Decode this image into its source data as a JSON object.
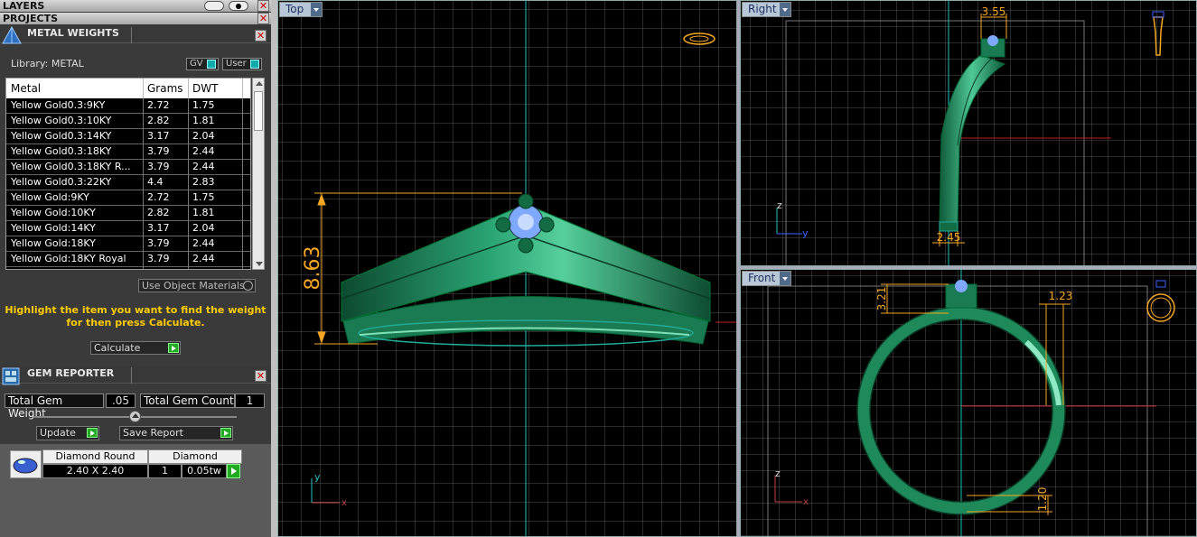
{
  "layers_title": "LAYERS",
  "projects_title": "PROJECTS",
  "close_glyph": "✕",
  "metal_weights": {
    "title": "METAL WEIGHTS",
    "library_label": "Library: METAL",
    "toggle_gv": "GV",
    "toggle_user": "User",
    "columns": [
      "Metal",
      "Grams",
      "DWT"
    ],
    "rows": [
      [
        "Yellow Gold0.3:9KY",
        "2.72",
        "1.75"
      ],
      [
        "Yellow Gold0.3:10KY",
        "2.82",
        "1.81"
      ],
      [
        "Yellow Gold0.3:14KY",
        "3.17",
        "2.04"
      ],
      [
        "Yellow Gold0.3:18KY",
        "3.79",
        "2.44"
      ],
      [
        "Yellow Gold0.3:18KY R...",
        "3.79",
        "2.44"
      ],
      [
        "Yellow Gold0.3:22KY",
        "4.4",
        "2.83"
      ],
      [
        "Yellow Gold:9KY",
        "2.72",
        "1.75"
      ],
      [
        "Yellow Gold:10KY",
        "2.82",
        "1.81"
      ],
      [
        "Yellow Gold:14KY",
        "3.17",
        "2.04"
      ],
      [
        "Yellow Gold:18KY",
        "3.79",
        "2.44"
      ],
      [
        "Yellow Gold:18KY Royal",
        "3.79",
        "2.44"
      ]
    ],
    "use_object_materials": "Use Object Materials",
    "hint_line1": "Highlight the item you want to find the weight",
    "hint_line2": "for then press Calculate.",
    "calculate_label": "Calculate"
  },
  "gem_reporter": {
    "title": "GEM REPORTER",
    "total_weight_label": "Total Gem Weight",
    "total_weight_value": ".05",
    "total_count_label": "Total Gem Count",
    "total_count_value": "1",
    "update_label": "Update",
    "save_report_label": "Save Report",
    "gem_name": "Diamond Round",
    "gem_type": "Diamond",
    "gem_size": "2.40 X 2.40",
    "gem_qty": "1",
    "gem_weight": "0.05tw"
  },
  "viewports": {
    "top_label": "Top",
    "right_label": "Right",
    "front_label": "Front",
    "dim_top_height": "8.63",
    "dim_right_top": "3.55",
    "dim_right_bottom": "2.45",
    "dim_front_left": "3.21",
    "dim_front_right": "1.23",
    "dim_front_bottom": "1.20",
    "axis_x": "x",
    "axis_y": "y",
    "axis_z": "z"
  },
  "colors": {
    "metal_green": "#1f8f5f",
    "dimension_orange": "#f5a623",
    "axis_cyan": "#20c0c0",
    "hint_yellow": "#ffcc00"
  }
}
